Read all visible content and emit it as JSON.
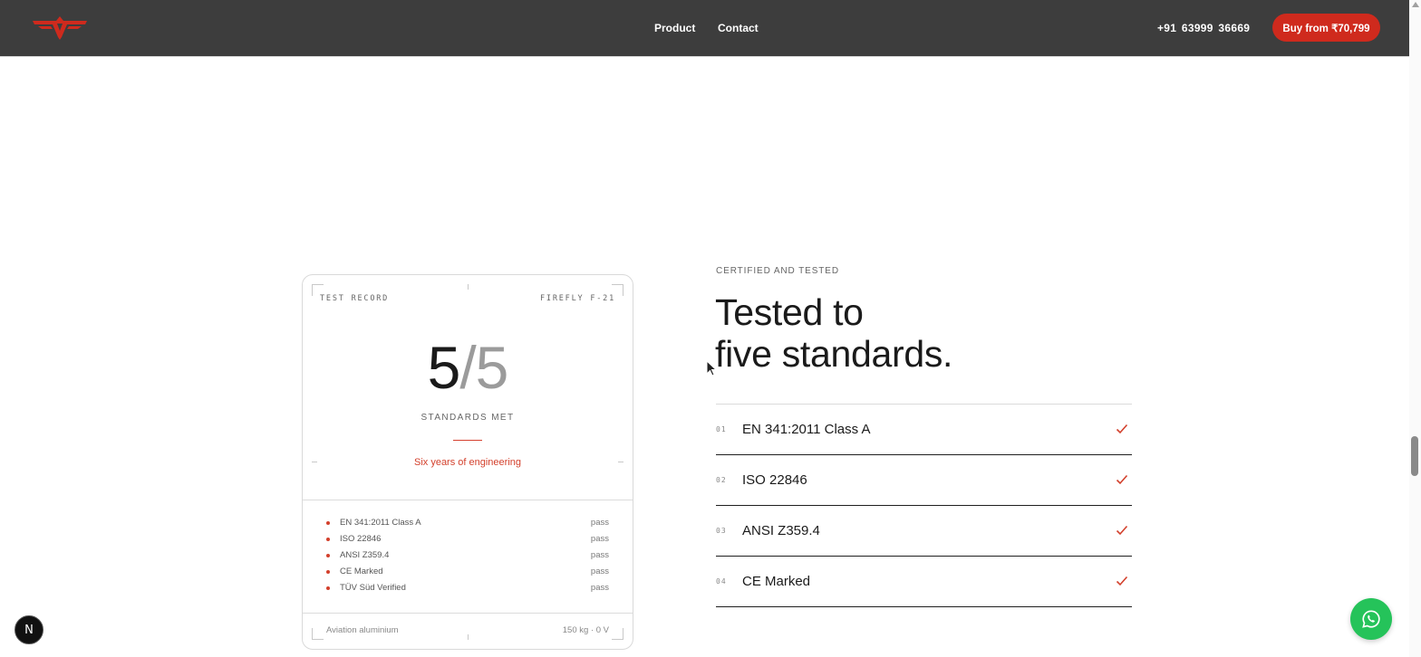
{
  "header": {
    "logo_icon": "winged-logo-icon",
    "nav": [
      {
        "label": "Product"
      },
      {
        "label": "Contact"
      }
    ],
    "phone": "+91 63999 36669",
    "cta_label": "Buy from ₹70,799"
  },
  "colors": {
    "header_bg": "#3d3d3d",
    "accent_red": "#cf2a1d",
    "whatsapp_green": "#25c35a"
  },
  "card": {
    "label_left": "TEST RECORD",
    "label_right": "FIREFLY F-21",
    "score_met": "5",
    "score_total": "/5",
    "score_caption": "STANDARDS MET",
    "tagline": "Six years of engineering",
    "results": [
      {
        "name": "EN 341:2011 Class A",
        "status": "pass"
      },
      {
        "name": "ISO 22846",
        "status": "pass"
      },
      {
        "name": "ANSI Z359.4",
        "status": "pass"
      },
      {
        "name": "CE Marked",
        "status": "pass"
      },
      {
        "name": "TÜV Süd Verified",
        "status": "pass"
      }
    ],
    "footer_left": "Aviation aluminium",
    "footer_right": "150 kg · 0 V"
  },
  "section": {
    "eyebrow": "CERTIFIED AND TESTED",
    "headline_line1": "Tested to",
    "headline_line2": "five standards.",
    "standards": [
      {
        "num": "01",
        "label": "EN 341:2011 Class A",
        "icon": "check-icon"
      },
      {
        "num": "02",
        "label": "ISO 22846",
        "icon": "check-icon"
      },
      {
        "num": "03",
        "label": "ANSI Z359.4",
        "icon": "check-icon"
      },
      {
        "num": "04",
        "label": "CE Marked",
        "icon": "check-icon"
      }
    ]
  },
  "floating": {
    "dev_badge": "N",
    "chat_icon": "whatsapp-icon"
  }
}
